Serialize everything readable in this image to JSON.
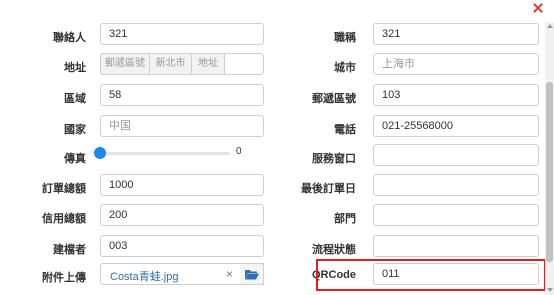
{
  "left": {
    "contact": {
      "label": "聯絡人",
      "value": "321"
    },
    "address": {
      "label": "地址",
      "zip_ph": "郵遞區號",
      "city_ph": "新北市",
      "addr_ph": "地址"
    },
    "area": {
      "label": "區域",
      "value": "58"
    },
    "country": {
      "label": "國家",
      "placeholder": "中国"
    },
    "fax": {
      "label": "傳真",
      "slider_value": "0"
    },
    "order_total": {
      "label": "訂單總額",
      "value": "1000"
    },
    "credit_total": {
      "label": "信用總額",
      "value": "200"
    },
    "creator": {
      "label": "建檔者",
      "value": "003"
    },
    "attachment": {
      "label": "附件上傳",
      "file": "Costa青蛙.jpg",
      "clear": "×"
    }
  },
  "right": {
    "title": {
      "label": "職稱",
      "value": "321"
    },
    "city": {
      "label": "城市",
      "placeholder": "上海市"
    },
    "zip": {
      "label": "郵遞區號",
      "value": "103"
    },
    "phone": {
      "label": "電話",
      "value": "021-25568000"
    },
    "service": {
      "label": "服務窗口",
      "value": ""
    },
    "last_order": {
      "label": "最後訂單日",
      "value": ""
    },
    "department": {
      "label": "部門",
      "value": ""
    },
    "flow_status": {
      "label": "流程狀態",
      "value": ""
    },
    "qrcode": {
      "label": "QRCode",
      "value": "011"
    }
  },
  "colors": {
    "accent": "#1e88e5",
    "highlight": "#e02020",
    "close": "#d8463a",
    "link": "#2f6fb3"
  },
  "icons": {
    "close": "close-icon",
    "folder": "folder-open-icon"
  }
}
